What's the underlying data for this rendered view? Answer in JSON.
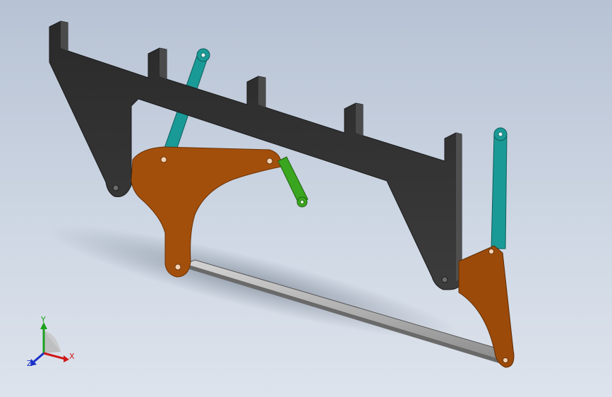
{
  "viewport": {
    "background_top": "#b7c2d4",
    "background_bottom": "#dde3ec"
  },
  "model": {
    "parts": [
      {
        "name": "saw-frame",
        "color": "#3a3a3a"
      },
      {
        "name": "left-bracket",
        "color": "#a34f0c"
      },
      {
        "name": "right-bracket",
        "color": "#9b4a0a"
      },
      {
        "name": "saw-blade",
        "color": "#b3b3b3"
      },
      {
        "name": "teal-link-left",
        "color": "#1a9a96"
      },
      {
        "name": "teal-link-right",
        "color": "#1a9a96"
      },
      {
        "name": "green-link",
        "color": "#3aa51f"
      }
    ]
  },
  "triad": {
    "x_label": "X",
    "y_label": "Y",
    "z_label": "Z",
    "x_color": "#d01818",
    "y_color": "#1ca01c",
    "z_color": "#1a2fc8"
  }
}
